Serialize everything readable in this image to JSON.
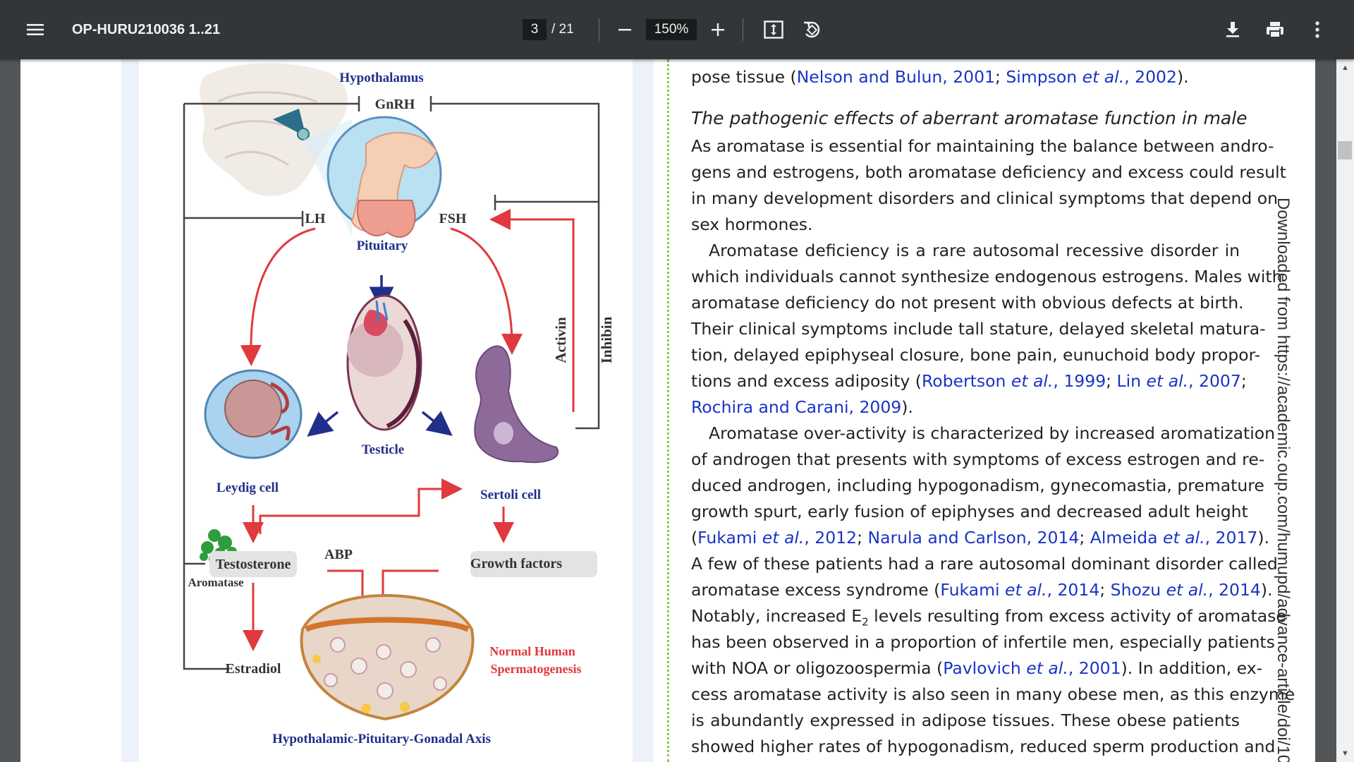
{
  "toolbar": {
    "title": "OP-HURU210036 1..21",
    "page_current": "3",
    "page_total": "/ 21",
    "zoom": "150%"
  },
  "icons": [
    "menu-icon",
    "minus-icon",
    "plus-icon",
    "fit-page-icon",
    "rotate-icon",
    "download-icon",
    "print-icon",
    "more-vert-icon"
  ],
  "figure": {
    "hypothalamus": "Hypothalamus",
    "gnrh": "GnRH",
    "lh": "LH",
    "fsh": "FSH",
    "pituitary": "Pituitary",
    "activin": "Activin",
    "inhibin": "Inhibin",
    "testicle": "Testicle",
    "leydig": "Leydig cell",
    "sertoli": "Sertoli cell",
    "testosterone": "Testosterone",
    "abp": "ABP",
    "growth_factors": "Growth factors",
    "aromatase": "Aromatase",
    "estradiol": "Estradiol",
    "normal_human": "Normal Human",
    "spermatogenesis": "Spermatogenesis",
    "axis_title": "Hypothalamic-Pituitary-Gonadal Axis"
  },
  "text": {
    "line0_pre": "pose tissue (",
    "line0_l1": "Nelson and Bulun, 2001",
    "line0_sep": "; ",
    "line0_l2a": "Simpson ",
    "line0_l2b": "et al.",
    "line0_l2c": ", 2002",
    "line0_post": ").",
    "heading": "The pathogenic effects of aberrant aromatase function in male",
    "p1_l1": "As aromatase is essential for maintaining the balance between andro-",
    "p1_l2": "gens and estrogens, both aromatase deficiency and excess could result",
    "p1_l3": "in many development disorders and clinical symptoms that depend on",
    "p1_l4": "sex hormones.",
    "p2_l1": "Aromatase deficiency is a rare autosomal recessive disorder in",
    "p2_l2": "which individuals cannot synthesize endogenous estrogens. Males with",
    "p2_l3": "aromatase deficiency do not present with obvious defects at birth.",
    "p2_l4": "Their clinical symptoms include tall stature, delayed skeletal matura-",
    "p2_l5": "tion, delayed epiphyseal closure, bone pain, eunuchoid body propor-",
    "p2_l6_pre": "tions and excess adiposity (",
    "p2_l6_l1a": "Robertson ",
    "p2_l6_l1b": "et al.",
    "p2_l6_l1c": ", 1999",
    "p2_l6_sep": "; ",
    "p2_l6_l2a": "Lin ",
    "p2_l6_l2b": "et al.",
    "p2_l6_l2c": ", 2007",
    "p2_l6_post": ";",
    "p2_l7_l1": "Rochira and Carani, 2009",
    "p2_l7_post": ").",
    "p3_l1": "Aromatase over-activity is characterized by increased aromatization",
    "p3_l2": "of androgen that presents with symptoms of excess estrogen and re-",
    "p3_l3": "duced androgen, including hypogonadism, gynecomastia, premature",
    "p3_l4": "growth spurt, early fusion of epiphyses and decreased adult height",
    "p3_l5_pre": "(",
    "p3_l5_l1a": "Fukami ",
    "p3_l5_l1b": "et al.",
    "p3_l5_l1c": ", 2012",
    "p3_l5_sep1": "; ",
    "p3_l5_l2": "Narula and Carlson, 2014",
    "p3_l5_sep2": "; ",
    "p3_l5_l3a": "Almeida ",
    "p3_l5_l3b": "et al.",
    "p3_l5_l3c": ", 2017",
    "p3_l5_post": ").",
    "p3_l6": "A few of these patients had a rare autosomal dominant disorder called",
    "p3_l7_pre": "aromatase excess syndrome (",
    "p3_l7_l1a": "Fukami ",
    "p3_l7_l1b": "et al.",
    "p3_l7_l1c": ", 2014",
    "p3_l7_sep": "; ",
    "p3_l7_l2a": "Shozu ",
    "p3_l7_l2b": "et al.",
    "p3_l7_l2c": ", 2014",
    "p3_l7_post": ").",
    "p3_l8_pre": "Notably, increased E",
    "p3_l8_sub": "2",
    "p3_l8_post": " levels resulting from excess activity of aromatase",
    "p3_l9": "has been observed in a proportion of infertile men, especially patients",
    "p3_l10_pre": "with NOA or oligozoospermia (",
    "p3_l10_l1a": "Pavlovich ",
    "p3_l10_l1b": "et al.",
    "p3_l10_l1c": ", 2001",
    "p3_l10_post": "). In addition, ex-",
    "p3_l11": "cess aromatase activity is also seen in many obese men, as this enzyme",
    "p3_l12": "is abundantly expressed in adipose tissues. These obese patients",
    "p3_l13": "showed higher rates of hypogonadism, reduced sperm production and"
  },
  "side_text": "Downloaded from https://academic.oup.com/humupd/advance-article/doi/10",
  "colors": {
    "toolbar": "#323639",
    "viewer_bg": "#525659",
    "link": "#1a33c4",
    "arrow_red": "#e0393e",
    "label_blue": "#1f2f8a",
    "dotted_green": "#8dc63f"
  }
}
